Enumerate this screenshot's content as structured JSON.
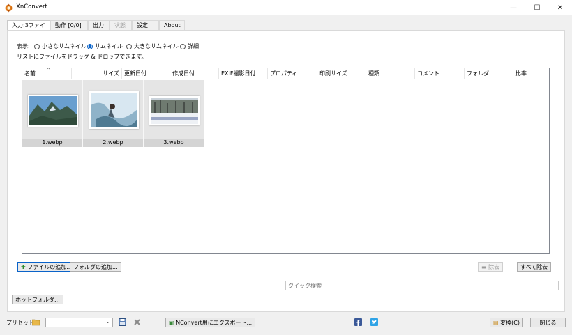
{
  "window": {
    "title": "XnConvert",
    "minimize": "—",
    "maximize": "☐",
    "close": "✕"
  },
  "tabs": [
    {
      "label": "入力:3ファイル"
    },
    {
      "label": "動作 [0/0]"
    },
    {
      "label": "出力"
    },
    {
      "label": "状態"
    },
    {
      "label": "設定"
    },
    {
      "label": "About"
    }
  ],
  "view": {
    "label": "表示:",
    "options": [
      "小さなサムネイル",
      "サムネイル",
      "大きなサムネイル",
      "詳細"
    ],
    "selected": "サムネイル",
    "hint": "リストにファイルをドラッグ & ドロップできます。"
  },
  "columns": [
    "名前",
    "サイズ",
    "更新日付",
    "作成日付",
    "EXIF撮影日付",
    "プロパティ",
    "印刷サイズ",
    "種類",
    "コメント",
    "フォルダ",
    "比率"
  ],
  "sort_indicator": "^",
  "files": [
    {
      "name": "1.webp",
      "icon": "mountain-landscape-thumbnail"
    },
    {
      "name": "2.webp",
      "icon": "ice-climber-thumbnail"
    },
    {
      "name": "3.webp",
      "icon": "snowy-trees-thumbnail"
    }
  ],
  "buttons": {
    "add_files": "ファイルの追加...",
    "add_folder": "フォルダの追加...",
    "remove": "除去",
    "remove_all": "すべて除去",
    "hot_folder": "ホットフォルダ...",
    "export": "NConvert用にエクスポート...",
    "convert": "変換(C)",
    "close": "閉じる"
  },
  "search": {
    "placeholder": "クイック検索"
  },
  "preset": {
    "label": "プリセット:",
    "value": ""
  },
  "colors": {
    "accent": "#0a63c9",
    "thumb_bg": "#e5e5e5",
    "caption_bg": "#d4d4d4"
  }
}
